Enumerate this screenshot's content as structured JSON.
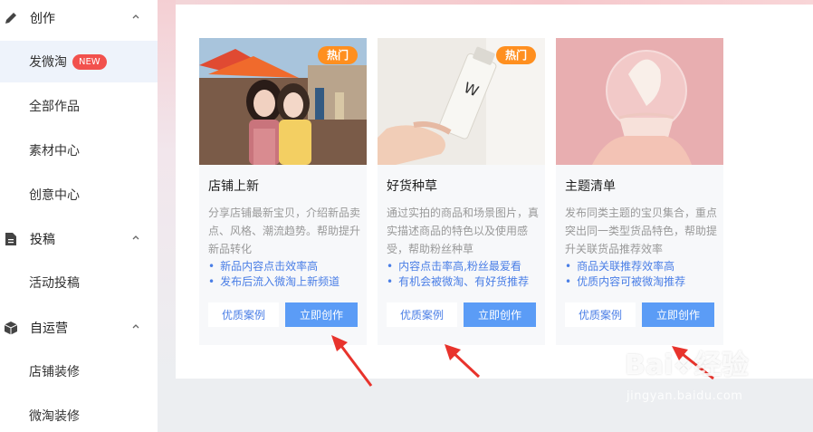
{
  "sidebar": {
    "groups": [
      {
        "label": "创作",
        "items": [
          {
            "label": "发微淘",
            "badge": "NEW",
            "active": true
          },
          {
            "label": "全部作品"
          },
          {
            "label": "素材中心"
          },
          {
            "label": "创意中心"
          }
        ]
      },
      {
        "label": "投稿",
        "items": [
          {
            "label": "活动投稿"
          }
        ]
      },
      {
        "label": "自运营",
        "items": [
          {
            "label": "店铺装修"
          },
          {
            "label": "微淘装修"
          }
        ]
      }
    ]
  },
  "cards": [
    {
      "hot_badge": "热门",
      "title": "店铺上新",
      "desc": "分享店铺最新宝贝，介绍新品卖点、风格、潮流趋势。帮助提升新品转化",
      "bullets": [
        "新品内容点击效率高",
        "发布后流入微淘上新频道"
      ],
      "case_btn": "优质案例",
      "create_btn": "立即创作"
    },
    {
      "hot_badge": "热门",
      "title": "好货种草",
      "desc": "通过实拍的商品和场景图片，真实描述商品的特色以及使用感受，帮助粉丝种草",
      "bullets": [
        "内容点击率高,粉丝最爱看",
        "有机会被微淘、有好货推荐"
      ],
      "case_btn": "优质案例",
      "create_btn": "立即创作"
    },
    {
      "title": "主题清单",
      "desc": "发布同类主题的宝贝集合，重点突出同一类型货品特色，帮助提升关联货品推荐效率",
      "bullets": [
        "商品关联推荐效率高",
        "优质内容可被微淘推荐"
      ],
      "case_btn": "优质案例",
      "create_btn": "立即创作"
    }
  ],
  "watermark": {
    "brand_left": "Bai",
    "brand_right": "经验",
    "url": "jingyan.baidu.com"
  },
  "colors": {
    "accent": "#5b9cf6",
    "hot": "#ff8f1f",
    "new_badge": "#f2514d",
    "arrow": "#e8332c"
  }
}
